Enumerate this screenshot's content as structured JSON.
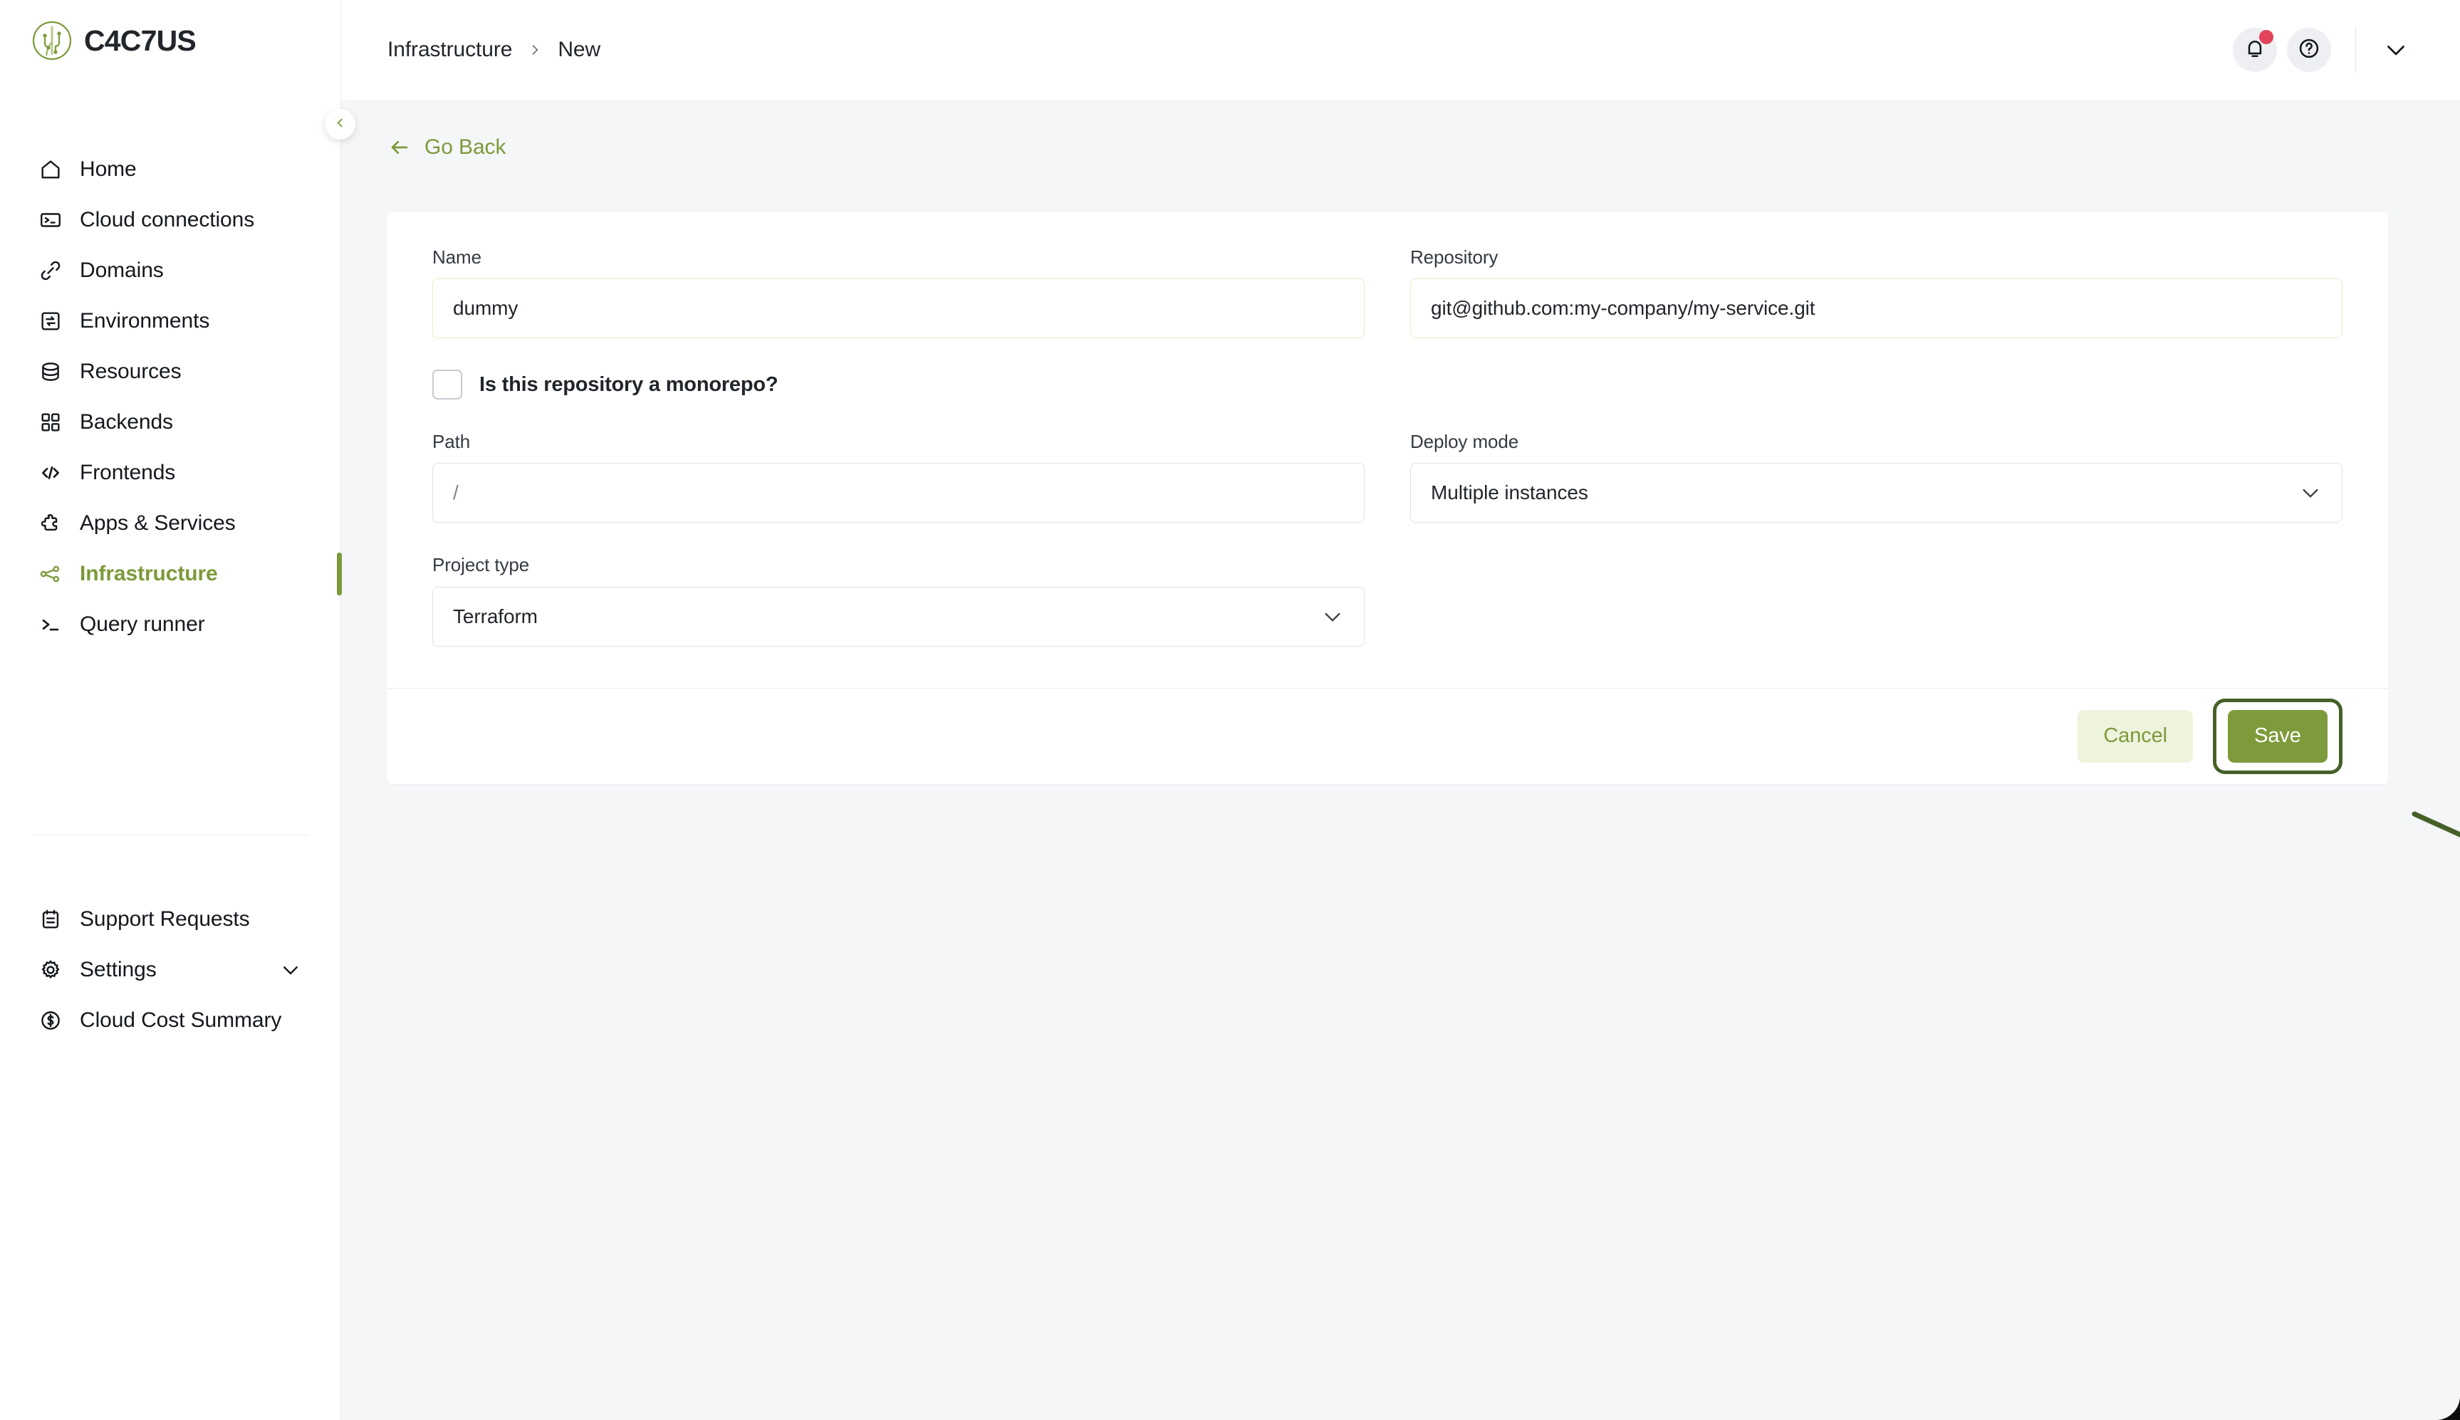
{
  "brand": {
    "name": "C4C7US",
    "logo_icon": "cactus-circle-logo",
    "accent_color": "#7c9a3a"
  },
  "sidebar": {
    "collapse_icon": "chevron-left-icon",
    "items": [
      {
        "label": "Home",
        "icon": "home-icon",
        "active": false
      },
      {
        "label": "Cloud connections",
        "icon": "terminal-box-icon",
        "active": false
      },
      {
        "label": "Domains",
        "icon": "link-icon",
        "active": false
      },
      {
        "label": "Environments",
        "icon": "swap-box-icon",
        "active": false
      },
      {
        "label": "Resources",
        "icon": "database-icon",
        "active": false
      },
      {
        "label": "Backends",
        "icon": "grid-squares-icon",
        "active": false
      },
      {
        "label": "Frontends",
        "icon": "code-brackets-icon",
        "active": false
      },
      {
        "label": "Apps & Services",
        "icon": "puzzle-piece-icon",
        "active": false
      },
      {
        "label": "Infrastructure",
        "icon": "nodes-graph-icon",
        "active": true
      },
      {
        "label": "Query runner",
        "icon": "terminal-prompt-icon",
        "active": false
      }
    ],
    "bottom_items": [
      {
        "label": "Support Requests",
        "icon": "clipboard-icon",
        "expandable": false
      },
      {
        "label": "Settings",
        "icon": "gear-icon",
        "expandable": true
      },
      {
        "label": "Cloud Cost Summary",
        "icon": "dollar-circle-icon",
        "expandable": false
      }
    ]
  },
  "topbar": {
    "breadcrumb": [
      {
        "label": "Infrastructure"
      },
      {
        "label": "New"
      }
    ],
    "separator_icon": "chevron-right-icon",
    "notifications_icon": "bell-icon",
    "notifications_badge": true,
    "help_icon": "question-circle-icon",
    "account_chevron_icon": "chevron-down-icon"
  },
  "page": {
    "go_back_label": "Go Back",
    "go_back_icon": "arrow-left-icon"
  },
  "form": {
    "name": {
      "label": "Name",
      "value": "dummy"
    },
    "repository": {
      "label": "Repository",
      "value": "git@github.com:my-company/my-service.git"
    },
    "monorepo": {
      "label": "Is this repository a monorepo?",
      "checked": false
    },
    "path": {
      "label": "Path",
      "value": "",
      "placeholder": "/"
    },
    "deploy_mode": {
      "label": "Deploy mode",
      "value": "Multiple instances",
      "chevron_icon": "chevron-down-icon"
    },
    "project_type": {
      "label": "Project type",
      "value": "Terraform",
      "chevron_icon": "chevron-down-icon"
    }
  },
  "footer": {
    "cancel_label": "Cancel",
    "save_label": "Save"
  },
  "annotation": {
    "arrow_color": "#466127",
    "highlight_color": "#466127",
    "target": "save-button"
  }
}
